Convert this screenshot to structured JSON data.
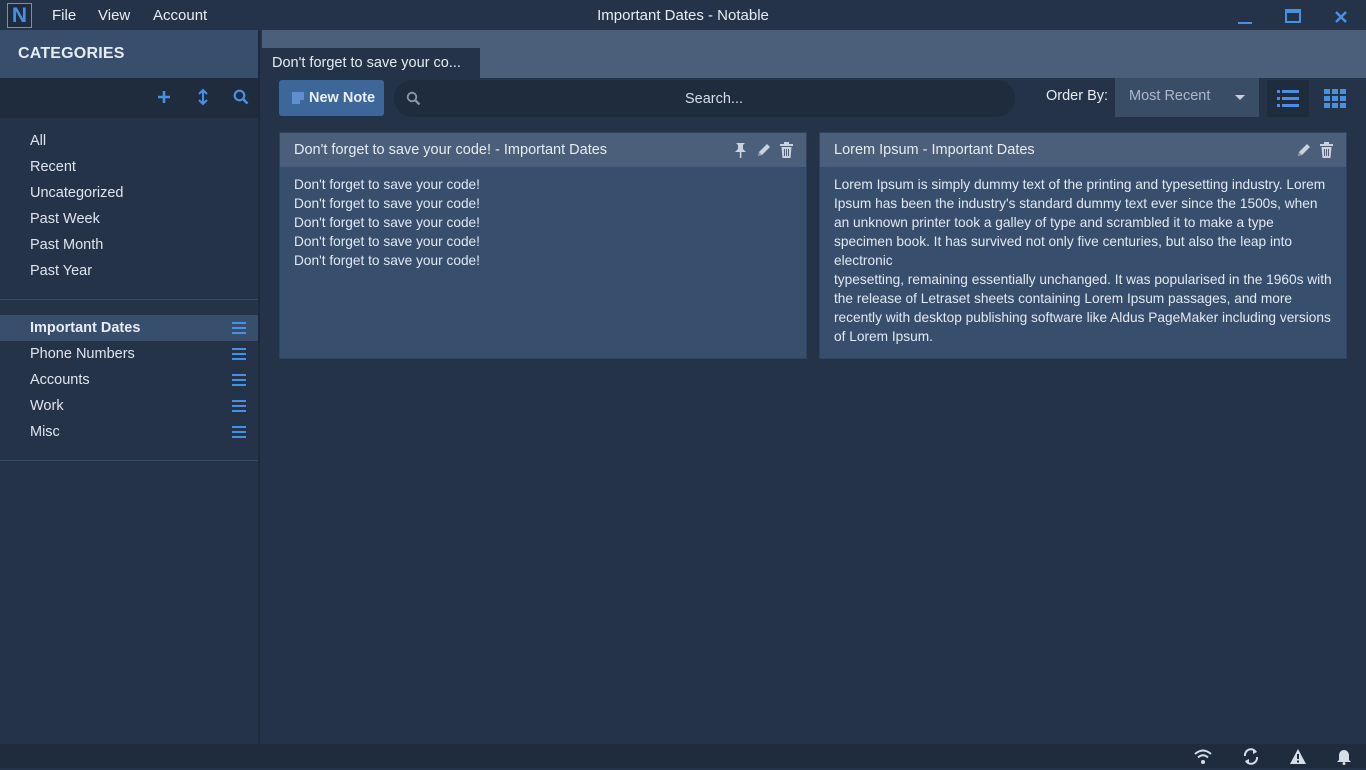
{
  "window": {
    "title": "Important Dates - Notable",
    "logo_letter": "N"
  },
  "menu": [
    "File",
    "View",
    "Account"
  ],
  "sidebar": {
    "header": "CATEGORIES",
    "nav_items": [
      "All",
      "Recent",
      "Uncategorized",
      "Past Week",
      "Past Month",
      "Past Year"
    ],
    "categories": [
      {
        "label": "Important Dates",
        "active": true
      },
      {
        "label": "Phone Numbers",
        "active": false
      },
      {
        "label": "Accounts",
        "active": false
      },
      {
        "label": "Work",
        "active": false
      },
      {
        "label": "Misc",
        "active": false
      }
    ]
  },
  "tabs": [
    {
      "label": "Don't forget to save your co..."
    }
  ],
  "toolbar": {
    "new_note_label": "New Note",
    "search_placeholder": "Search...",
    "order_by_label": "Order By:",
    "order_by_value": "Most Recent"
  },
  "notes": [
    {
      "title": "Don't forget to save your code!  -  Important Dates",
      "lines": [
        "Don't forget to save your code!",
        "Don't forget to save your code!",
        "Don't forget to save your code!",
        "Don't forget to save your code!",
        "Don't forget to save your code!"
      ],
      "pinned": true
    },
    {
      "title": "Lorem Ipsum  -  Important Dates",
      "lines": [
        "Lorem Ipsum is simply dummy text of the printing and typesetting industry. Lorem Ipsum has been the industry's standard dummy text ever since the 1500s, when an unknown printer took a galley of type and scrambled it to make a type specimen book. It has survived not only five centuries, but also the leap into electronic",
        "typesetting, remaining essentially unchanged. It was popularised in the 1960s with the release of Letraset sheets containing Lorem Ipsum passages, and more recently with desktop publishing software like Aldus PageMaker including versions of Lorem Ipsum."
      ],
      "pinned": false
    }
  ],
  "colors": {
    "background": "#253348",
    "panel": "#374e6d",
    "accent": "#4a90e2",
    "button": "#3d6799"
  }
}
